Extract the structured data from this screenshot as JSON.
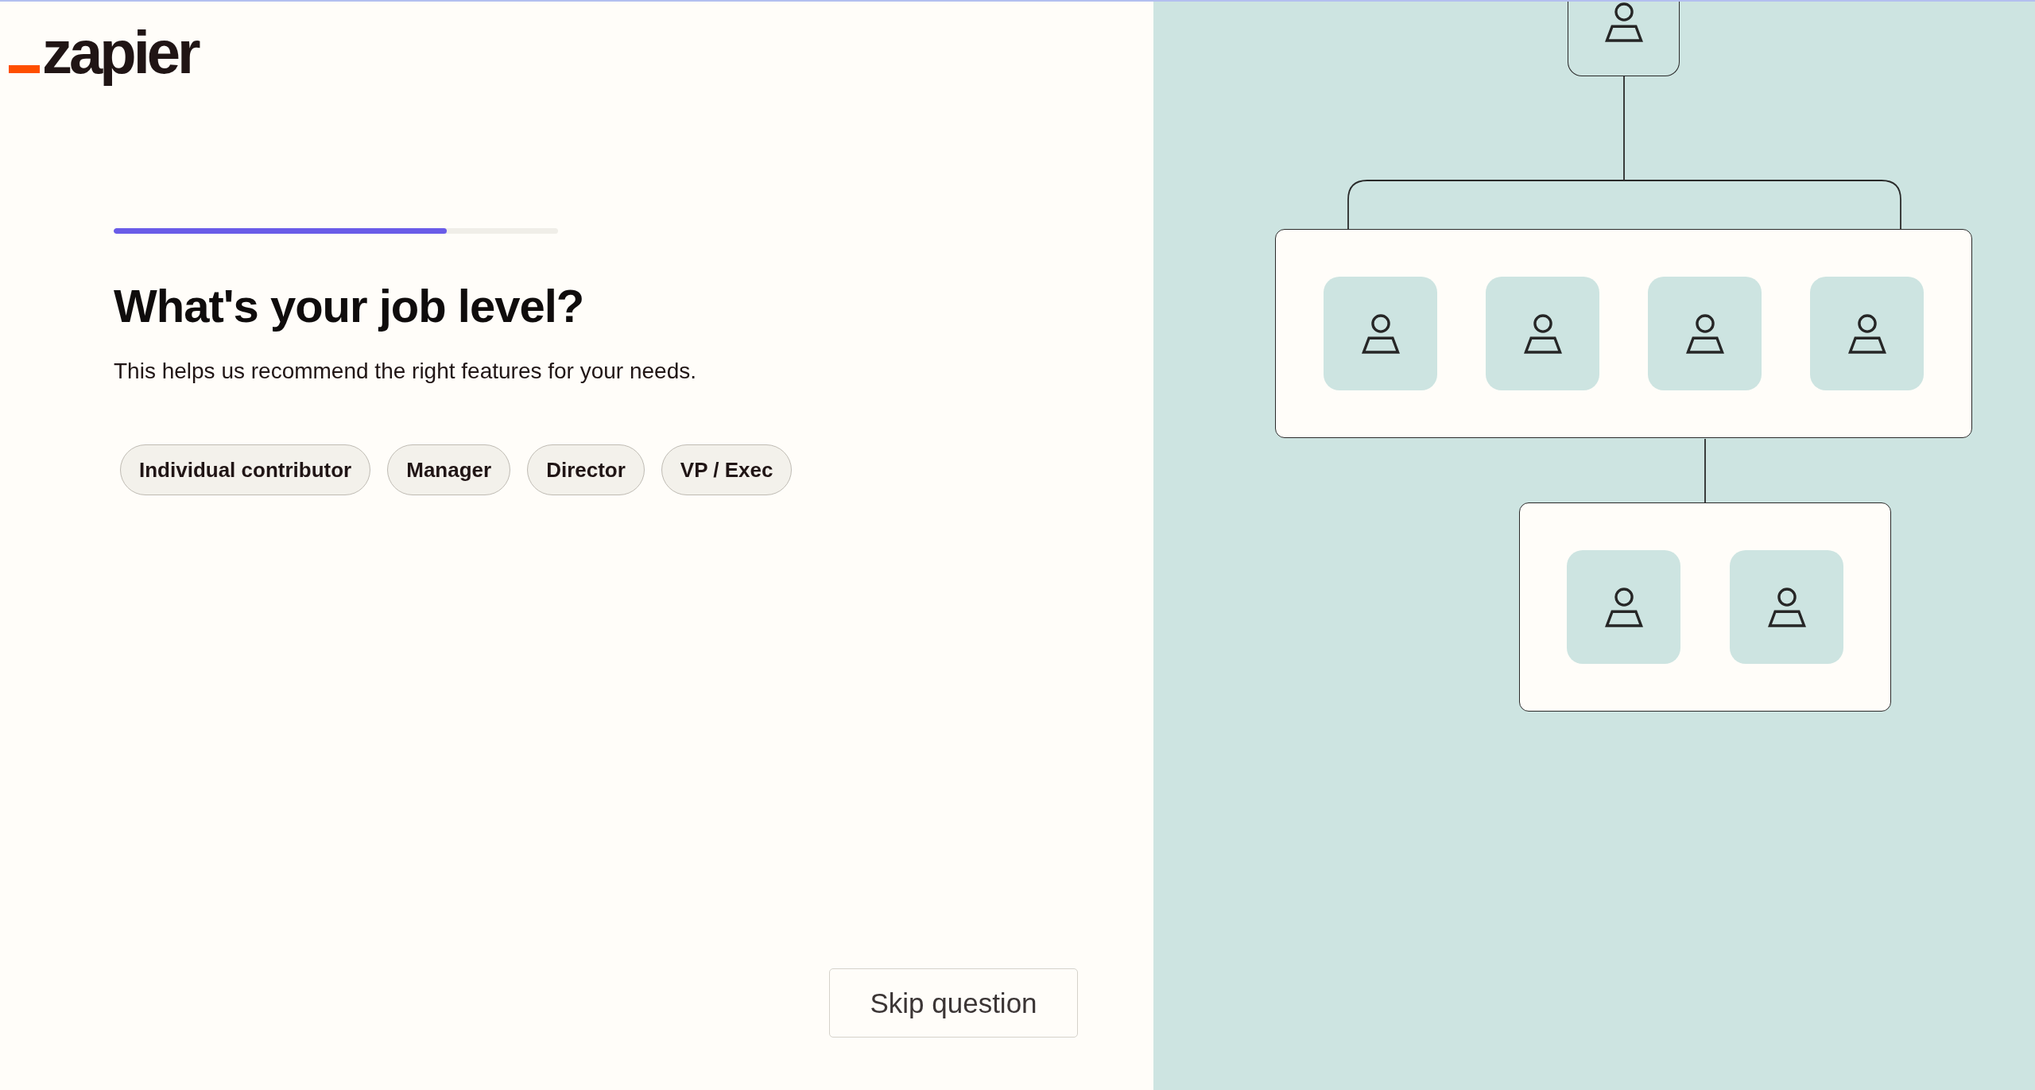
{
  "logo": {
    "text": "zapier"
  },
  "progress": {
    "level": 0.75
  },
  "question": {
    "title": "What's your job level?",
    "subtitle": "This helps us recommend the right features for your needs."
  },
  "options": [
    {
      "label": "Individual contributor",
      "selected": false
    },
    {
      "label": "Manager",
      "selected": false
    },
    {
      "label": "Director",
      "selected": false
    },
    {
      "label": "VP / Exec",
      "selected": false
    }
  ],
  "skip_button": {
    "label": "Skip question"
  }
}
